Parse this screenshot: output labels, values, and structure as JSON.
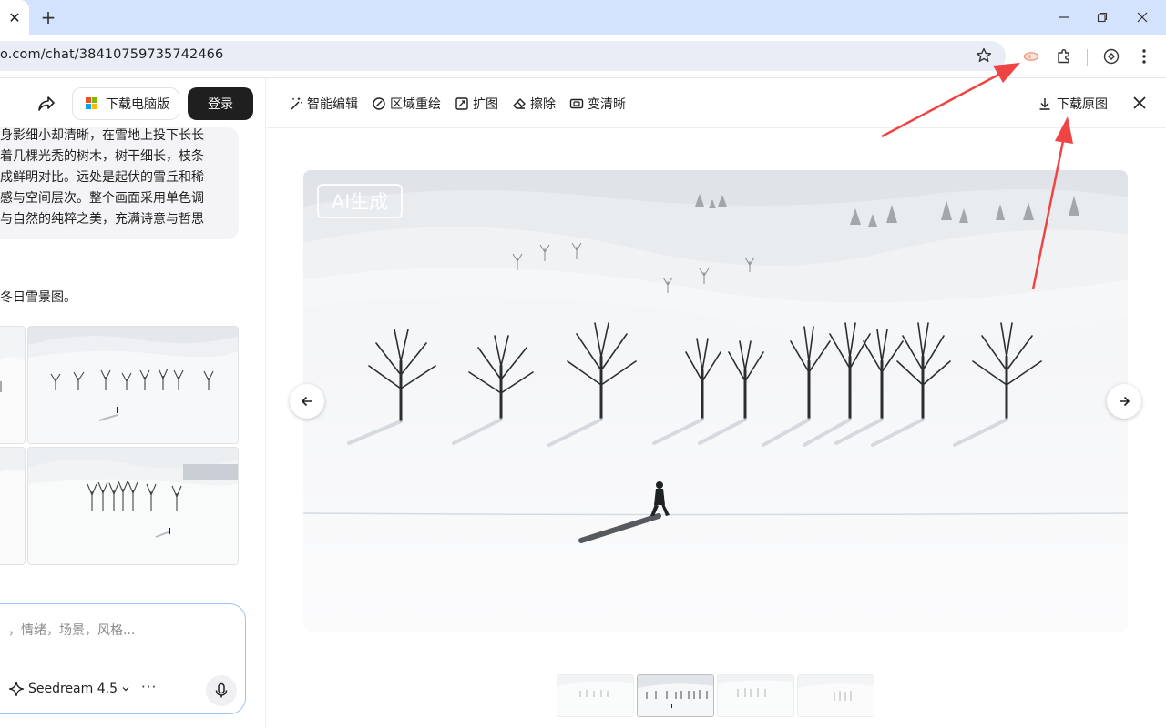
{
  "browser": {
    "tab_close": "✕",
    "new_tab": "+",
    "url": "o.com/chat/38410759735742466"
  },
  "left_panel": {
    "download_pc_label": "下载电脑版",
    "login_label": "登录",
    "message_lines": [
      "身影细小却清晰，在雪地上投下长长",
      "着几棵光秃的树木，树干细长，枝条",
      "成鲜明对比。远处是起伏的雪丘和稀",
      "感与空间层次。整个画面采用单色调",
      "与自然的纯粹之美，充满诗意与哲思"
    ],
    "reply_text": "冬日雪景图。",
    "composer": {
      "placeholder": "，情绪，场景，风格...",
      "model_label": "Seedream 4.5",
      "more_label": "···"
    }
  },
  "viewer": {
    "tools": [
      {
        "label": "智能编辑",
        "icon": "magic-wand-icon"
      },
      {
        "label": "区域重绘",
        "icon": "brush-icon"
      },
      {
        "label": "扩图",
        "icon": "expand-icon"
      },
      {
        "label": "擦除",
        "icon": "eraser-icon"
      },
      {
        "label": "变清晰",
        "icon": "hd-icon"
      }
    ],
    "download_original_label": "下载原图",
    "ai_badge": "AI生成"
  },
  "colors": {
    "accent_annotation": "#ef4444",
    "login_bg": "#1f1f1f",
    "tabstrip": "#d3e3fd",
    "composer_border": "#9ec2ff"
  }
}
